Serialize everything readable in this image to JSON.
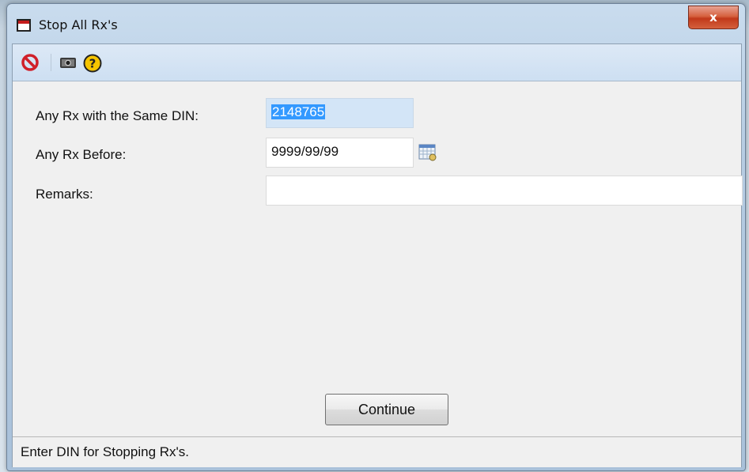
{
  "window": {
    "title": "Stop All Rx's",
    "close_label": "x"
  },
  "toolbar": {
    "icons": [
      "stop-icon",
      "screen-icon",
      "help-icon"
    ]
  },
  "form": {
    "din_label": "Any Rx with the Same DIN:",
    "din_value": "2148765",
    "before_label": "Any Rx Before:",
    "before_value": "9999/99/99",
    "remarks_label": "Remarks:",
    "remarks_value": ""
  },
  "actions": {
    "continue_label": "Continue"
  },
  "status": {
    "text": "Enter DIN for Stopping Rx's."
  },
  "colors": {
    "toolbar_bg": "#cddff2",
    "selection": "#3399ff",
    "close_button": "#c1391a"
  }
}
